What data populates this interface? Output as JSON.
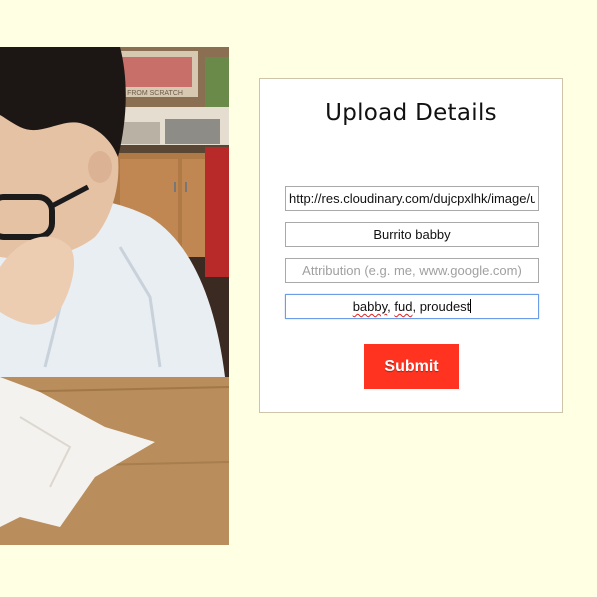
{
  "photo": {
    "sign_text": "FROM SCRATCH"
  },
  "upload_form": {
    "title": "Upload Details",
    "url_value": "http://res.cloudinary.com/dujcpxlhk/image/u",
    "title_value": "Burrito babby",
    "attribution_placeholder": "Attribution (e.g. me, www.google.com)",
    "attribution_value": "",
    "tags_value": "babby, fud, proudest",
    "tags_parts": [
      "babby",
      ", ",
      "fud",
      ", ",
      "proudest"
    ],
    "submit_label": "Submit"
  },
  "colors": {
    "page_background": "#ffffe3",
    "submit_background": "#ff3320",
    "focus_border": "#6b9de8"
  }
}
